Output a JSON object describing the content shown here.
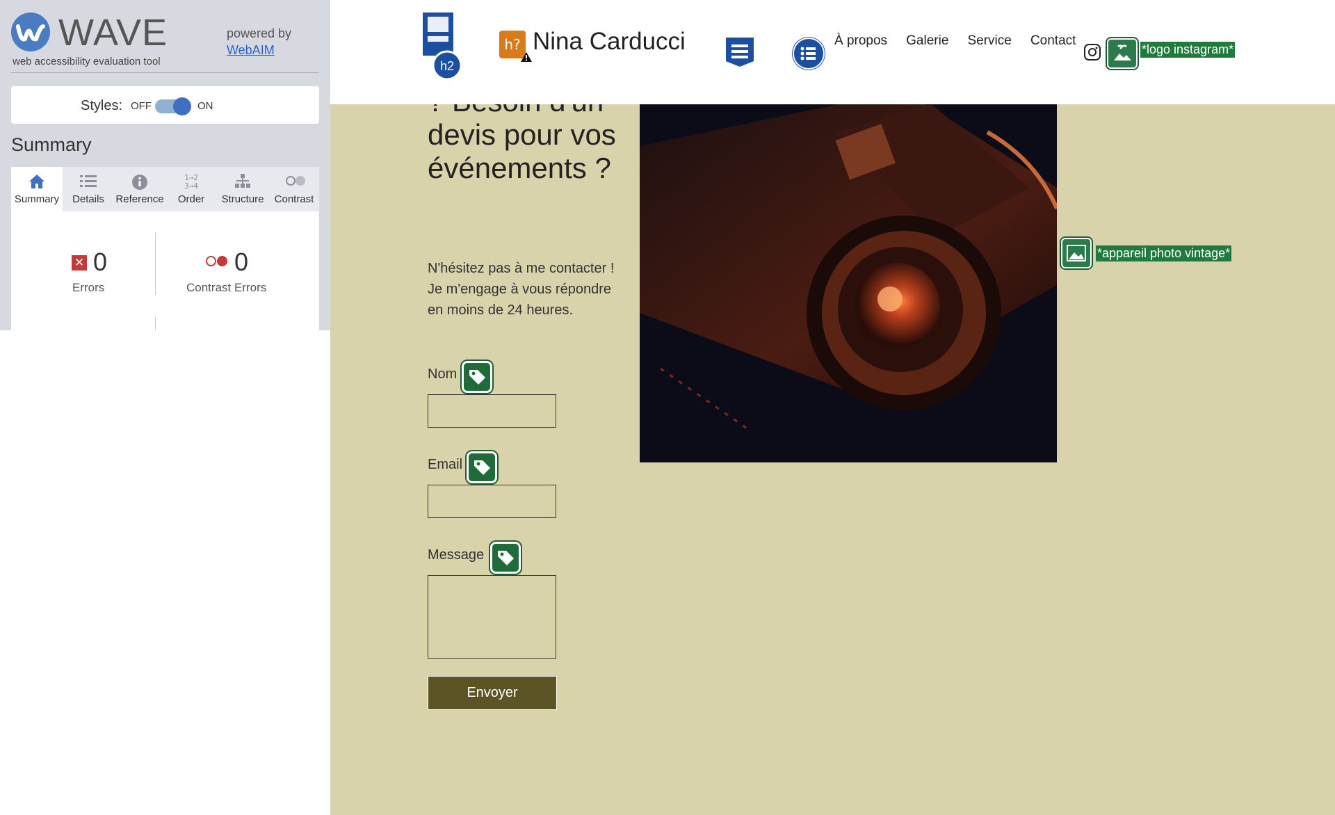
{
  "wave": {
    "title": "WAVE",
    "subtitle": "web accessibility evaluation tool",
    "powered_by": "powered by",
    "webaim_link": "WebAIM",
    "styles_label": "Styles:",
    "styles_off": "OFF",
    "styles_on": "ON",
    "styles_enabled": true,
    "summary_heading": "Summary",
    "tabs": [
      {
        "label": "Summary",
        "icon": "home-icon",
        "active": true
      },
      {
        "label": "Details",
        "icon": "list-icon",
        "active": false
      },
      {
        "label": "Reference",
        "icon": "info-icon",
        "active": false
      },
      {
        "label": "Order",
        "icon": "order-icon",
        "active": false
      },
      {
        "label": "Structure",
        "icon": "structure-icon",
        "active": false
      },
      {
        "label": "Contrast",
        "icon": "contrast-icon",
        "active": false
      }
    ],
    "errors": {
      "count": "0",
      "label": "Errors"
    },
    "contrast_errors": {
      "count": "0",
      "label": "Contrast Errors"
    }
  },
  "site": {
    "brand": "Nina Carducci",
    "h2_badge": "h2",
    "h2_unknown_badge": "h?",
    "nav": [
      "À propos",
      "Galerie",
      "Service",
      "Contact"
    ],
    "instagram_alt": "*logo instagram*",
    "photo_alt": "*appareil photo vintage*",
    "heading": "des questions ? Besoin d'un devis pour vos événements ?",
    "intro": "N'hésitez pas à me contacter ! Je m'engage à vous répondre en moins de 24 heures.",
    "form": {
      "name_label": "Nom",
      "email_label": "Email",
      "message_label": "Message",
      "submit": "Envoyer"
    }
  },
  "colors": {
    "page_bg": "#d8d3aa",
    "button_bg": "#5c5425",
    "wave_accent": "#3f6fbf",
    "wave_badge_green": "#1f7a3e",
    "error_red": "#c23a3a"
  }
}
